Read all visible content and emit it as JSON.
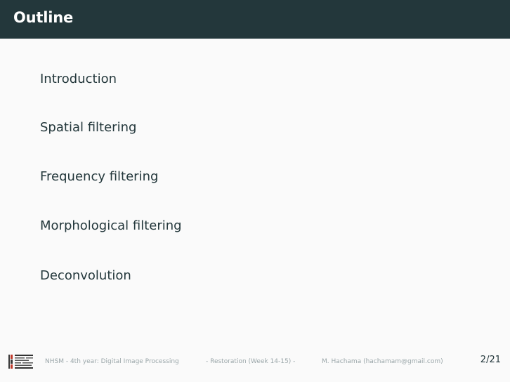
{
  "slide": {
    "title": "Outline",
    "items": [
      "Introduction",
      "Spatial filtering",
      "Frequency filtering",
      "Morphological filtering",
      "Deconvolution"
    ]
  },
  "footer": {
    "course": "NHSM - 4th year: Digital Image Processing",
    "section": "- Restoration (Week 14-15) -",
    "author": "M. Hachama (hachamam@gmail.com)",
    "page": "2/21"
  },
  "colors": {
    "title_bar": "#23373b",
    "background": "#fafafa",
    "text": "#23373b",
    "footer_text": "#9aa6a9"
  },
  "icons": {
    "logo": "institution-logo"
  }
}
